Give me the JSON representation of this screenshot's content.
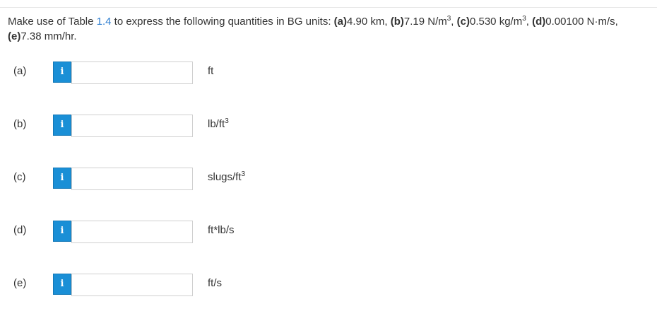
{
  "question": {
    "prefix": "Make use of Table ",
    "table_ref": "1.4",
    "mid": " to express the following quantities in BG units: ",
    "a_label": "(a)",
    "a_val": "4.90 km, ",
    "b_label": "(b)",
    "b_val": "7.19 N/m",
    "b_sup": "3",
    "b_sep": ", ",
    "c_label": "(c)",
    "c_val": "0.530 kg/m",
    "c_sup": "3",
    "c_sep": ", ",
    "d_label": "(d)",
    "d_val": "0.00100 N·m/s,",
    "e_label": "(e)",
    "e_val": "7.38 mm/hr."
  },
  "info_glyph": "i",
  "parts": [
    {
      "label": "(a)",
      "value": "",
      "unit": "ft",
      "unit_sup": ""
    },
    {
      "label": "(b)",
      "value": "",
      "unit": "lb/ft",
      "unit_sup": "3"
    },
    {
      "label": "(c)",
      "value": "",
      "unit": "slugs/ft",
      "unit_sup": "3"
    },
    {
      "label": "(d)",
      "value": "",
      "unit": "ft*lb/s",
      "unit_sup": ""
    },
    {
      "label": "(e)",
      "value": "",
      "unit": "ft/s",
      "unit_sup": ""
    }
  ],
  "colors": {
    "info_button": "#1a8fd6",
    "link": "#2f7fd0",
    "text": "#333333"
  }
}
